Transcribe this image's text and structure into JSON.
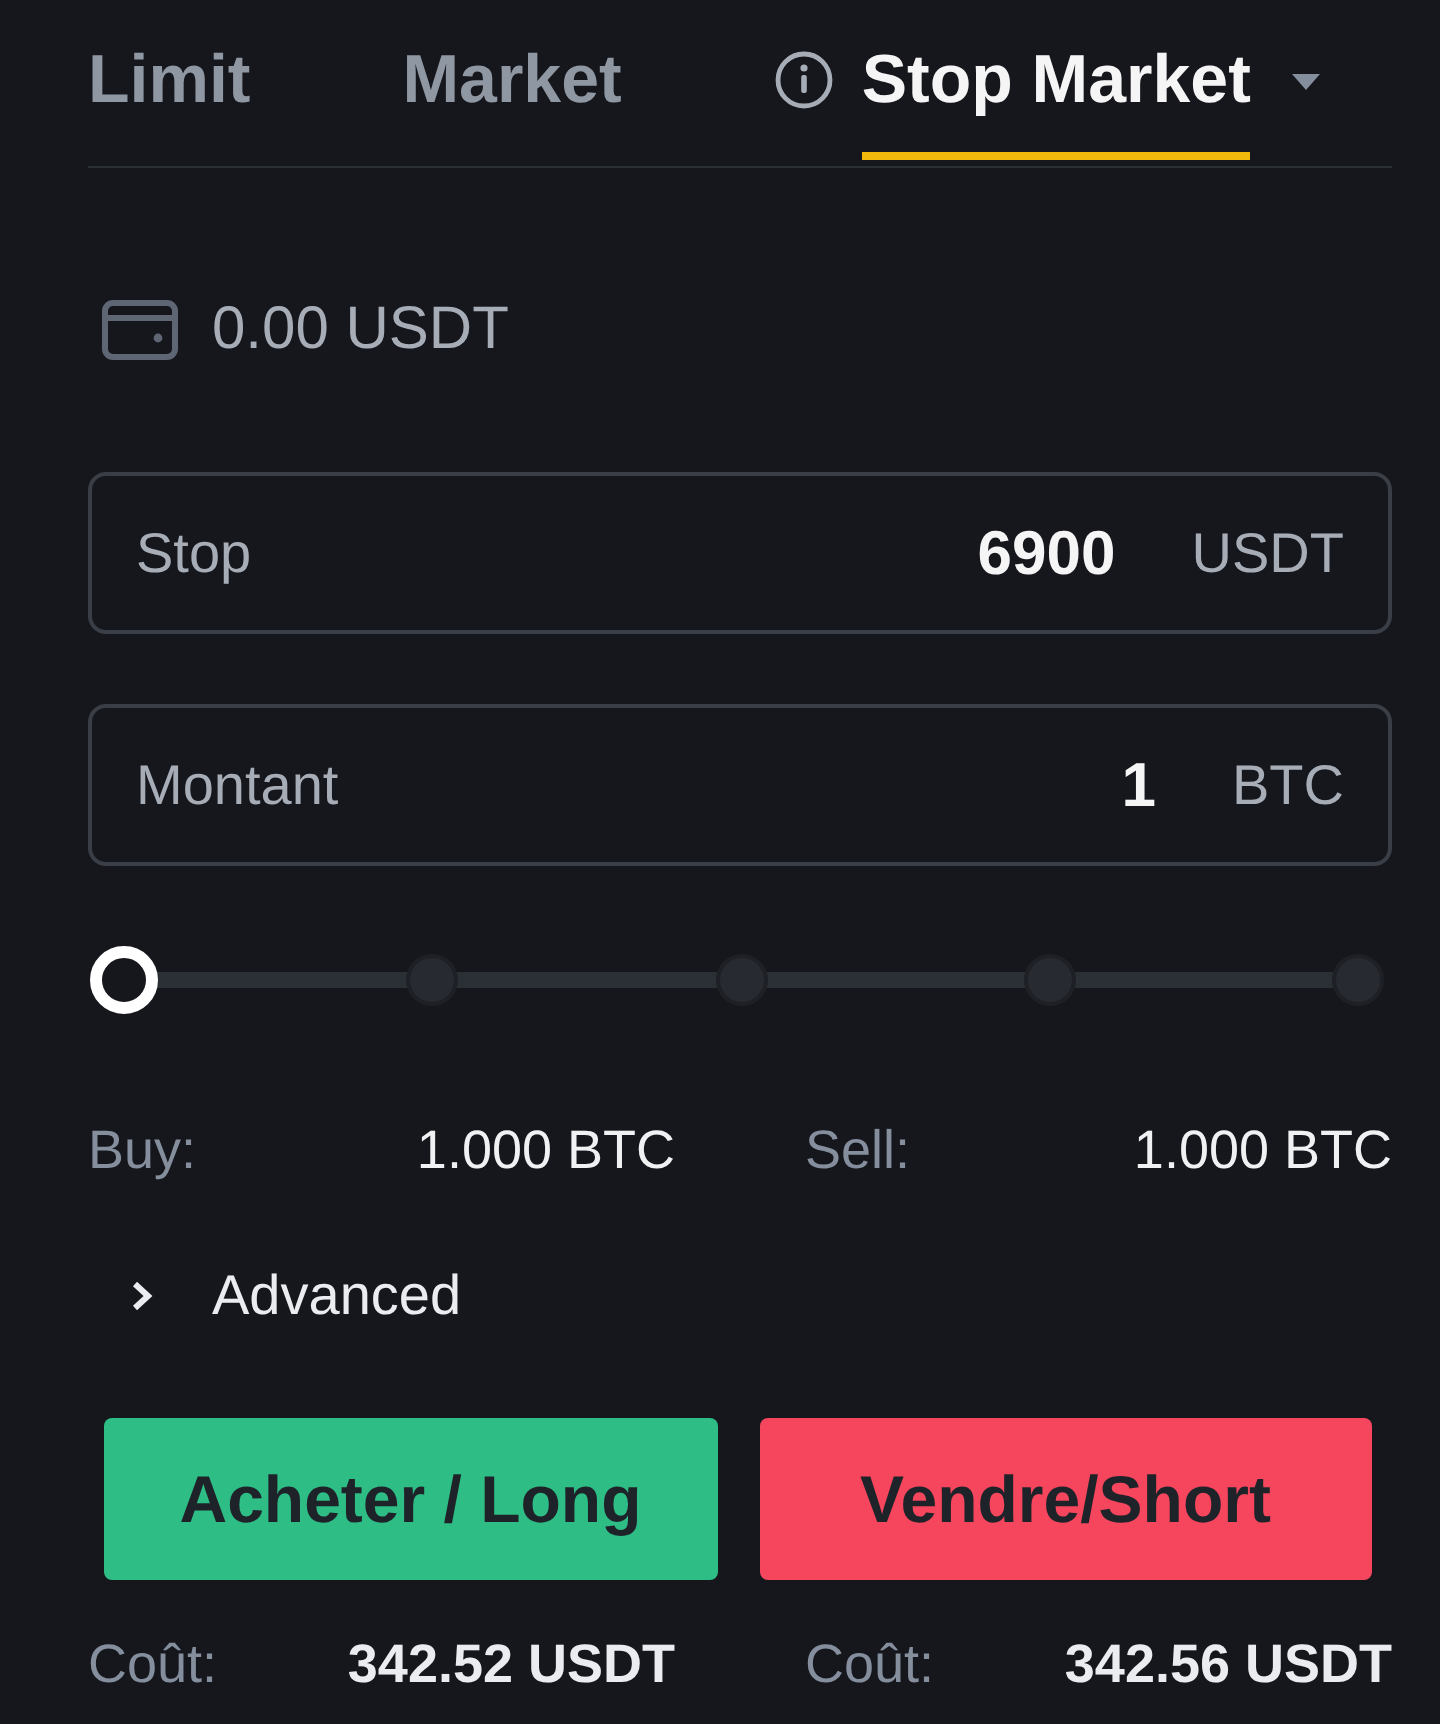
{
  "tabs": [
    {
      "label": "Limit",
      "selected": false,
      "kind": "plain"
    },
    {
      "label": "Market",
      "selected": false,
      "kind": "plain"
    },
    {
      "label": "Stop Market",
      "selected": true,
      "kind": "dropdown"
    }
  ],
  "balance": {
    "value": "0.00 USDT"
  },
  "fields": [
    {
      "label": "Stop",
      "value": "6900",
      "unit": "USDT"
    },
    {
      "label": "Montant",
      "value": "1",
      "unit": "BTC"
    }
  ],
  "slider": {
    "level": 0
  },
  "max_amounts": [
    {
      "label": "Buy:",
      "value": "1.000 BTC"
    },
    {
      "label": "Sell:",
      "value": "1.000 BTC"
    }
  ],
  "advanced": {
    "label": "Advanced",
    "expanded": false
  },
  "actions": [
    {
      "label": "Acheter / Long",
      "kind": "buy"
    },
    {
      "label": "Vendre/Short",
      "kind": "sell"
    }
  ],
  "costs": [
    {
      "label": "Coût:",
      "value": "342.52 USDT"
    },
    {
      "label": "Coût:",
      "value": "342.56 USDT"
    }
  ]
}
